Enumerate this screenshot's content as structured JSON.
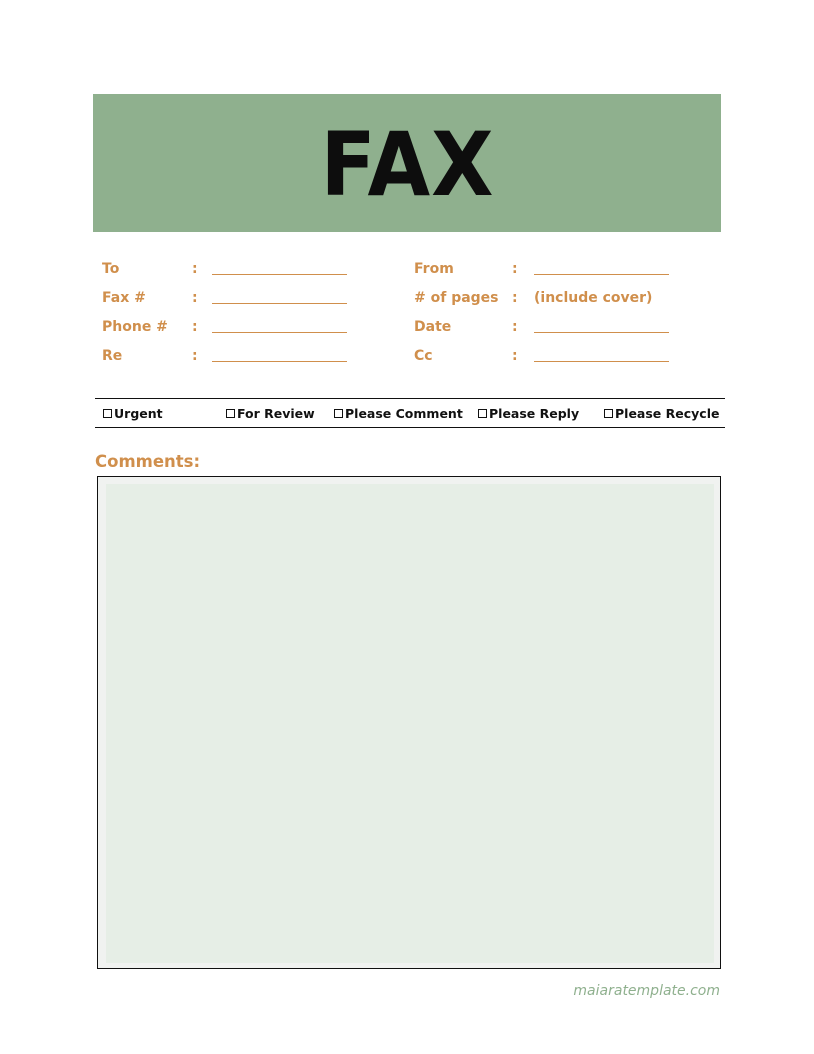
{
  "header": {
    "title": "FAX",
    "banner_color": "#8fb08e"
  },
  "accent_color": "#d08f4c",
  "fields": {
    "left": [
      {
        "label": "To",
        "separator": ":",
        "value": ""
      },
      {
        "label": "Fax #",
        "separator": ":",
        "value": ""
      },
      {
        "label": "Phone #",
        "separator": ":",
        "value": ""
      },
      {
        "label": "Re",
        "separator": ":",
        "value": ""
      }
    ],
    "right": [
      {
        "label": "From",
        "separator": ":",
        "value": ""
      },
      {
        "label": "# of pages",
        "separator": ":",
        "value": "(include cover)"
      },
      {
        "label": "Date",
        "separator": ":",
        "value": ""
      },
      {
        "label": "Cc",
        "separator": ":",
        "value": ""
      }
    ]
  },
  "checkboxes": [
    {
      "label": "Urgent",
      "checked": false
    },
    {
      "label": "For Review",
      "checked": false
    },
    {
      "label": "Please Comment",
      "checked": false
    },
    {
      "label": "Please Reply",
      "checked": false
    },
    {
      "label": "Please Recycle",
      "checked": false
    }
  ],
  "comments": {
    "title": "Comments:",
    "value": ""
  },
  "footer": {
    "watermark": "maiaratemplate.com"
  }
}
